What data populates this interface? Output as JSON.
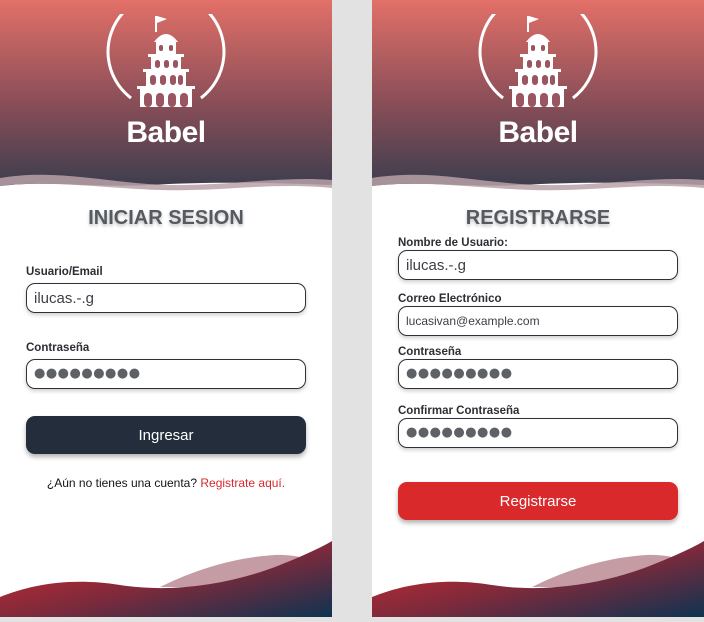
{
  "brand": {
    "name": "Babel"
  },
  "colors": {
    "primary_dark": "#232d3b",
    "accent_red": "#d9292b",
    "header_top": "#e27068",
    "header_bottom": "#3d3e4e"
  },
  "login": {
    "title": "INICIAR SESION",
    "username_label": "Usuario/Email",
    "username_value": "ilucas.-.g",
    "password_label": "Contraseña",
    "password_mask": "●●●●●●●●●",
    "submit_label": "Ingresar",
    "no_account_text": "¿Aún no tienes una cuenta?",
    "register_link": "Registrate aquí."
  },
  "register": {
    "title": "REGISTRARSE",
    "username_label": "Nombre de Usuario:",
    "username_value": "ilucas.-.g",
    "email_label": "Correo Electrónico",
    "email_value": "lucasivan@example.com",
    "password_label": "Contraseña",
    "password_mask": "●●●●●●●●●",
    "confirm_label": "Confirmar Contraseña",
    "confirm_mask": "●●●●●●●●●",
    "submit_label": "Registrarse"
  },
  "icons": {
    "logo": "babel-tower-logo-icon"
  }
}
